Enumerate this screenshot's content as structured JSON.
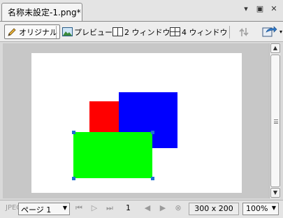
{
  "document_tab": {
    "title": "名称未設定-1.png*"
  },
  "window_controls": {
    "menu": "▾",
    "restore": "▣",
    "close": "✕"
  },
  "toolbar": {
    "original_label": "オリジナル",
    "preview_label": "プレビュー",
    "two_window_label": "2 ウィンドウ",
    "four_window_label": "4 ウィンドウ"
  },
  "canvas": {
    "shapes": [
      {
        "name": "red-rectangle",
        "color": "#ff0000"
      },
      {
        "name": "blue-rectangle",
        "color": "#0000ff"
      },
      {
        "name": "green-rectangle",
        "color": "#00ff00",
        "selected": true
      }
    ],
    "selection_handle_color": "#1f6fd6"
  },
  "statusbar": {
    "format": "JPEG",
    "page_selector": "ページ 1",
    "page_number": "1",
    "image_size": "300 x 200",
    "zoom": "100%"
  }
}
